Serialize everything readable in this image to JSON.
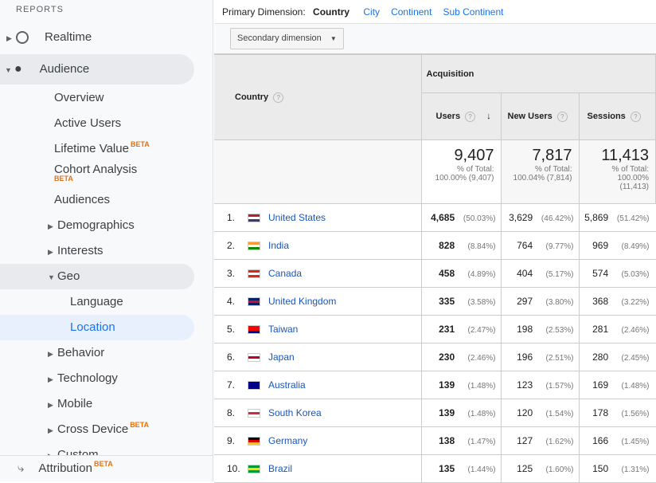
{
  "sidebar": {
    "section": "REPORTS",
    "realtime": "Realtime",
    "audience": "Audience",
    "overview": "Overview",
    "active_users": "Active Users",
    "lifetime_value": "Lifetime Value",
    "cohort": "Cohort Analysis",
    "audiences": "Audiences",
    "demographics": "Demographics",
    "interests": "Interests",
    "geo": "Geo",
    "language": "Language",
    "location": "Location",
    "behavior": "Behavior",
    "technology": "Technology",
    "mobile": "Mobile",
    "cross_device": "Cross Device",
    "custom": "Custom",
    "attribution": "Attribution",
    "beta": "BETA"
  },
  "primary": {
    "label": "Primary Dimension:",
    "active": "Country",
    "options": [
      "City",
      "Continent",
      "Sub Continent"
    ]
  },
  "secondary": "Secondary dimension",
  "table": {
    "country_header": "Country",
    "group": "Acquisition",
    "cols": [
      "Users",
      "New Users",
      "Sessions"
    ],
    "totals": [
      {
        "value": "9,407",
        "label": "% of Total:",
        "pct": "100.00% (9,407)"
      },
      {
        "value": "7,817",
        "label": "% of Total:",
        "pct": "100.04% (7,814)"
      },
      {
        "value": "11,413",
        "label": "% of Total:",
        "pct": "100.00% (11,413)"
      }
    ],
    "rows": [
      {
        "rank": "1.",
        "country": "United States",
        "flag": [
          "#b22234",
          "#fff",
          "#3c3b6e"
        ],
        "users": "4,685",
        "users_pct": "(50.03%)",
        "new": "3,629",
        "new_pct": "(46.42%)",
        "sessions": "5,869",
        "sessions_pct": "(51.42%)"
      },
      {
        "rank": "2.",
        "country": "India",
        "flag": [
          "#ff9933",
          "#fff",
          "#138808"
        ],
        "users": "828",
        "users_pct": "(8.84%)",
        "new": "764",
        "new_pct": "(9.77%)",
        "sessions": "969",
        "sessions_pct": "(8.49%)"
      },
      {
        "rank": "3.",
        "country": "Canada",
        "flag": [
          "#d52b1e",
          "#fff",
          "#d52b1e"
        ],
        "users": "458",
        "users_pct": "(4.89%)",
        "new": "404",
        "new_pct": "(5.17%)",
        "sessions": "574",
        "sessions_pct": "(5.03%)"
      },
      {
        "rank": "4.",
        "country": "United Kingdom",
        "flag": [
          "#012169",
          "#c8102e",
          "#012169"
        ],
        "users": "335",
        "users_pct": "(3.58%)",
        "new": "297",
        "new_pct": "(3.80%)",
        "sessions": "368",
        "sessions_pct": "(3.22%)"
      },
      {
        "rank": "5.",
        "country": "Taiwan",
        "flag": [
          "#fe0000",
          "#fe0000",
          "#000095"
        ],
        "users": "231",
        "users_pct": "(2.47%)",
        "new": "198",
        "new_pct": "(2.53%)",
        "sessions": "281",
        "sessions_pct": "(2.46%)"
      },
      {
        "rank": "6.",
        "country": "Japan",
        "flag": [
          "#fff",
          "#bc002d",
          "#fff"
        ],
        "users": "230",
        "users_pct": "(2.46%)",
        "new": "196",
        "new_pct": "(2.51%)",
        "sessions": "280",
        "sessions_pct": "(2.45%)"
      },
      {
        "rank": "7.",
        "country": "Australia",
        "flag": [
          "#00008b",
          "#00008b",
          "#00008b"
        ],
        "users": "139",
        "users_pct": "(1.48%)",
        "new": "123",
        "new_pct": "(1.57%)",
        "sessions": "169",
        "sessions_pct": "(1.48%)"
      },
      {
        "rank": "8.",
        "country": "South Korea",
        "flag": [
          "#fff",
          "#cd2e3a",
          "#fff"
        ],
        "users": "139",
        "users_pct": "(1.48%)",
        "new": "120",
        "new_pct": "(1.54%)",
        "sessions": "178",
        "sessions_pct": "(1.56%)"
      },
      {
        "rank": "9.",
        "country": "Germany",
        "flag": [
          "#000",
          "#dd0000",
          "#ffce00"
        ],
        "users": "138",
        "users_pct": "(1.47%)",
        "new": "127",
        "new_pct": "(1.62%)",
        "sessions": "166",
        "sessions_pct": "(1.45%)"
      },
      {
        "rank": "10.",
        "country": "Brazil",
        "flag": [
          "#009c3b",
          "#ffdf00",
          "#009c3b"
        ],
        "users": "135",
        "users_pct": "(1.44%)",
        "new": "125",
        "new_pct": "(1.60%)",
        "sessions": "150",
        "sessions_pct": "(1.31%)"
      }
    ]
  }
}
